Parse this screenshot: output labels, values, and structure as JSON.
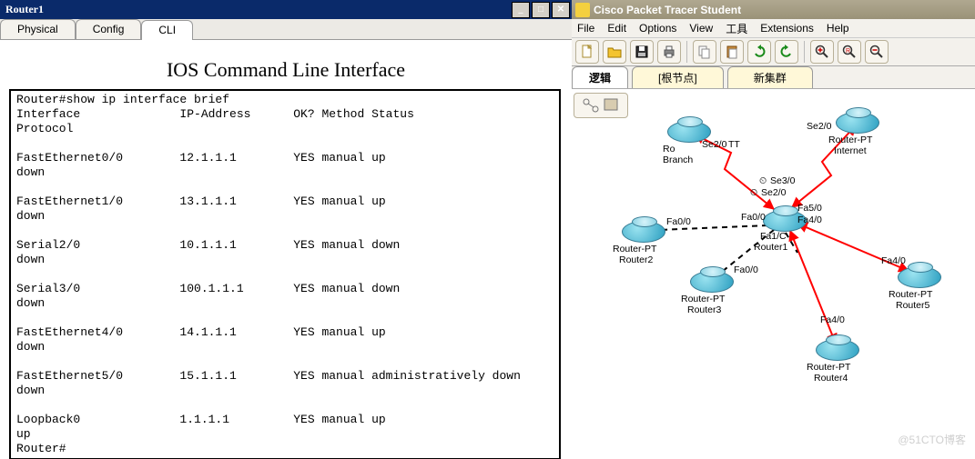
{
  "router_window": {
    "title": "Router1",
    "tabs": {
      "physical": "Physical",
      "config": "Config",
      "cli": "CLI"
    },
    "cli_heading": "IOS Command Line Interface",
    "prompt": "Router#",
    "command": "show ip interface brief",
    "columns": "Interface              IP-Address      OK? Method Status\nProtocol",
    "lines": [
      "Router#show ip interface brief",
      "Interface              IP-Address      OK? Method Status",
      "Protocol",
      "",
      "FastEthernet0/0        12.1.1.1        YES manual up",
      "down",
      "",
      "FastEthernet1/0        13.1.1.1        YES manual up",
      "down",
      "",
      "Serial2/0              10.1.1.1        YES manual down",
      "down",
      "",
      "Serial3/0              100.1.1.1       YES manual down",
      "down",
      "",
      "FastEthernet4/0        14.1.1.1        YES manual up",
      "down",
      "",
      "FastEthernet5/0        15.1.1.1        YES manual administratively down",
      "down",
      "",
      "Loopback0              1.1.1.1         YES manual up",
      "up",
      "Router#"
    ],
    "interfaces": [
      {
        "name": "FastEthernet0/0",
        "ip": "12.1.1.1",
        "ok": "YES",
        "method": "manual",
        "status": "up",
        "protocol": "down"
      },
      {
        "name": "FastEthernet1/0",
        "ip": "13.1.1.1",
        "ok": "YES",
        "method": "manual",
        "status": "up",
        "protocol": "down"
      },
      {
        "name": "Serial2/0",
        "ip": "10.1.1.1",
        "ok": "YES",
        "method": "manual",
        "status": "down",
        "protocol": "down"
      },
      {
        "name": "Serial3/0",
        "ip": "100.1.1.1",
        "ok": "YES",
        "method": "manual",
        "status": "down",
        "protocol": "down"
      },
      {
        "name": "FastEthernet4/0",
        "ip": "14.1.1.1",
        "ok": "YES",
        "method": "manual",
        "status": "up",
        "protocol": "down"
      },
      {
        "name": "FastEthernet5/0",
        "ip": "15.1.1.1",
        "ok": "YES",
        "method": "manual",
        "status": "administratively down",
        "protocol": "down"
      },
      {
        "name": "Loopback0",
        "ip": "1.1.1.1",
        "ok": "YES",
        "method": "manual",
        "status": "up",
        "protocol": "up"
      }
    ]
  },
  "pt_window": {
    "title": "Cisco Packet Tracer Student",
    "menu": {
      "file": "File",
      "edit": "Edit",
      "options": "Options",
      "view": "View",
      "tools": "工具",
      "extensions": "Extensions",
      "help": "Help"
    },
    "toolbar": {
      "new": "new",
      "open": "open",
      "save": "save",
      "print": "print",
      "copy": "copy",
      "paste": "paste",
      "undo": "undo",
      "redo": "redo",
      "zoom_in": "zoom-in",
      "zoom_reset": "zoom-reset",
      "zoom_out": "zoom-out"
    },
    "tab_logical": "逻辑",
    "btn_root": "[根节点]",
    "btn_new_cluster": "新集群",
    "devices": {
      "branch": {
        "model": "Ro",
        "name": "Branch"
      },
      "internet": {
        "model": "Router-PT",
        "name": "Internet"
      },
      "router1": {
        "model": "Fa1/C",
        "name": "Router1"
      },
      "router2": {
        "model": "Router-PT",
        "name": "Router2"
      },
      "router3": {
        "model": "Router-PT",
        "name": "Router3"
      },
      "router4": {
        "model": "Router-PT",
        "name": "Router4"
      },
      "router5": {
        "model": "Router-PT",
        "name": "Router5"
      }
    },
    "link_labels": {
      "branch_se20": "Se2/0",
      "branch_tt": "TT",
      "internet_se20": "Se2/0",
      "r1_se30": "Se3/0",
      "r1_se20": "Se2/0",
      "r1_fa00": "Fa0/0",
      "r1_fa40": "Fa4/0",
      "r1_fa50": "Fa5/0",
      "r2_fa00": "Fa0/0",
      "r3_fa00": "Fa0/0",
      "r4_fa40": "Fa4/0",
      "r5_fa40": "Fa4/0",
      "clock1": "⏲",
      "clock2": "⏲"
    },
    "watermark": "@51CTO博客"
  }
}
